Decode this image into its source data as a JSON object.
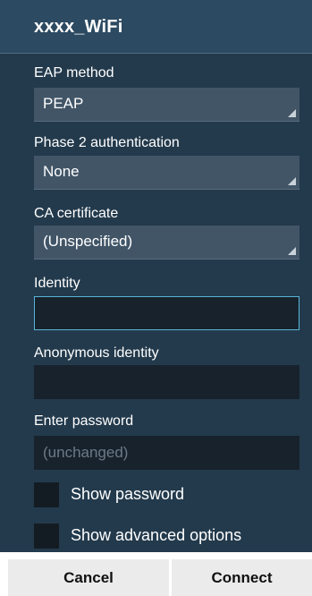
{
  "dialog": {
    "title": "xxxx_WiFi"
  },
  "fields": {
    "eap_method": {
      "label": "EAP method",
      "value": "PEAP"
    },
    "phase2": {
      "label": "Phase 2 authentication",
      "value": "None"
    },
    "ca_certificate": {
      "label": "CA certificate",
      "value": "(Unspecified)"
    },
    "identity": {
      "label": "Identity",
      "value": ""
    },
    "anonymous_identity": {
      "label": "Anonymous identity",
      "value": ""
    },
    "password": {
      "label": "Enter password",
      "placeholder": "(unchanged)"
    }
  },
  "checkboxes": {
    "show_password": {
      "label": "Show password",
      "checked": false
    },
    "show_advanced": {
      "label": "Show advanced options",
      "checked": false
    }
  },
  "buttons": {
    "cancel": "Cancel",
    "connect": "Connect"
  },
  "colors": {
    "dialog_background": "#233a4c",
    "title_background": "#2c4a61",
    "focus_accent": "#59b5d7"
  }
}
